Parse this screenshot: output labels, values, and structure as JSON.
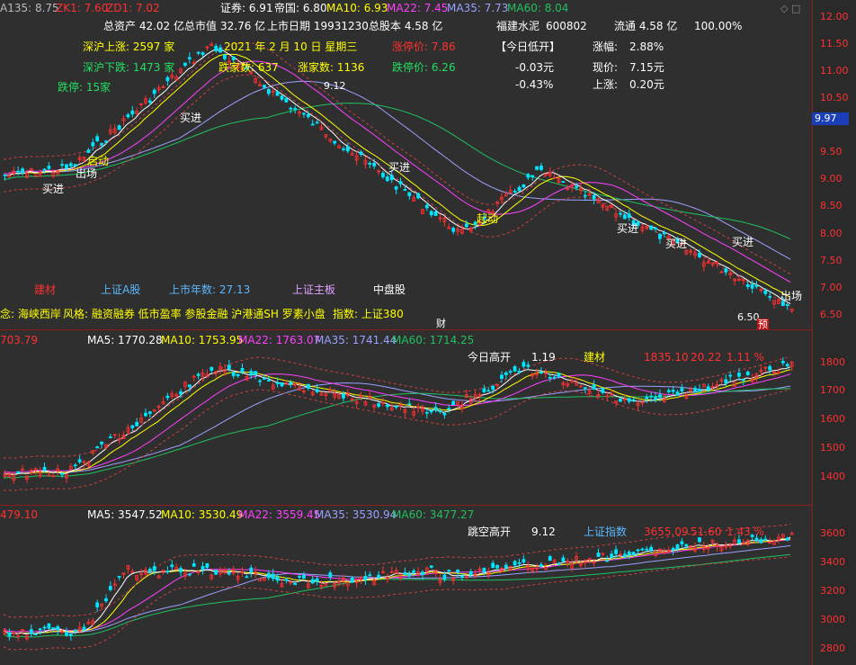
{
  "top_bar": {
    "ma135": "A135: 8.75",
    "zk1": "ZK1: 7.60",
    "zd1": "ZD1: 7.02",
    "quan": "证券: 6.91",
    "diguo": "帝国: 6.80",
    "ma10": "MA10: 6.93",
    "ma22": "MA22: 7.45",
    "ma35": "MA35: 7.73",
    "ma60": "MA60: 8.04"
  },
  "info": {
    "total_assets": "总资产 42.02 亿",
    "total_mktcap_label": "总市值",
    "total_mktcap_val": "32.76 亿",
    "listing_date": "上市日期 19931230",
    "total_shares": "总股本 4.58 亿",
    "stock_name": "福建水泥",
    "stock_code": "600802",
    "float_shares": "流通 4.58 亿",
    "float_pct": "100.00%",
    "sz_up": "深沪上涨: 2597 家",
    "date": "2021 年 2 月 10 日 星期三",
    "limit_up_price": "涨停价: 7.86",
    "today_low_open": "【今日低开】",
    "change_pct_label": "涨幅:",
    "change_pct": "2.88%",
    "sz_down": "深沪下跌: 1473 家",
    "falling_count": "跌家数: 637",
    "rising_count": "涨家数: 1136",
    "limit_down_price": "跌停价: 6.26",
    "open_diff": "-0.03元",
    "price_label": "现价:",
    "price": "7.15元",
    "limit_up_count": "跌停: 15家",
    "open_pct": "-0.43%",
    "rise_label": "上涨:",
    "rise_val": "0.20元",
    "label_912": "9.12"
  },
  "tags": {
    "sector": "建材",
    "board_a": "上证A股",
    "listing_years": "上市年数: 27.13",
    "main_board": "上证主板",
    "mid_cap": "中盘股",
    "concept": "念: 海峡西岸",
    "style": "风格: 融资融券 低市盈率 参股金融 沪港通SH 罗素小盘",
    "index": "指数: 上证380",
    "cai": "财",
    "low_mark": "6.50",
    "yu": "预"
  },
  "annotations": {
    "buy": "买进",
    "launch": "启动",
    "exit": "出场",
    "start": "起动"
  },
  "panel2": {
    "left_val": "703.79",
    "ma5": "MA5: 1770.28",
    "ma10": "MA10: 1753.95",
    "ma22": "MA22: 1763.07",
    "ma35": "MA35: 1741.44",
    "ma60": "MA60: 1714.25",
    "today_high_open": "今日高开",
    "today_high_open_val": "1.19",
    "sector": "建材",
    "sector_val": "1835.10",
    "sector_chg": "20.22",
    "sector_pct": "1.11 %"
  },
  "panel3": {
    "left_val": "479.10",
    "ma5": "MA5: 3547.52",
    "ma10": "MA10: 3530.49",
    "ma22": "MA22: 3559.45",
    "ma35": "MA35: 3530.94",
    "ma60": "MA60: 3477.27",
    "gap_high_open": "跳空高开",
    "gap_high_open_val": "9.12",
    "index_name": "上证指数",
    "index_val": "3655.09",
    "index_chg": "51.60",
    "index_pct": "1.43 %"
  },
  "axis": {
    "p1": [
      "12.00",
      "11.50",
      "11.00",
      "10.50",
      "9.50",
      "9.00",
      "8.50",
      "8.00",
      "7.50",
      "7.00",
      "6.50"
    ],
    "current_tag": "9.97",
    "p2": [
      "1800",
      "1700",
      "1600",
      "1500",
      "1400"
    ],
    "p3": [
      "3600",
      "3400",
      "3200",
      "3000",
      "2800"
    ]
  },
  "colors": {
    "up": "#ff3030",
    "down": "#00e5ff",
    "ma5": "#ffffff",
    "ma10": "#ffff00",
    "ma22": "#ff40ff",
    "ma35": "#9aa0ff",
    "ma60": "#20c060",
    "separator": "#8b1d1d"
  }
}
